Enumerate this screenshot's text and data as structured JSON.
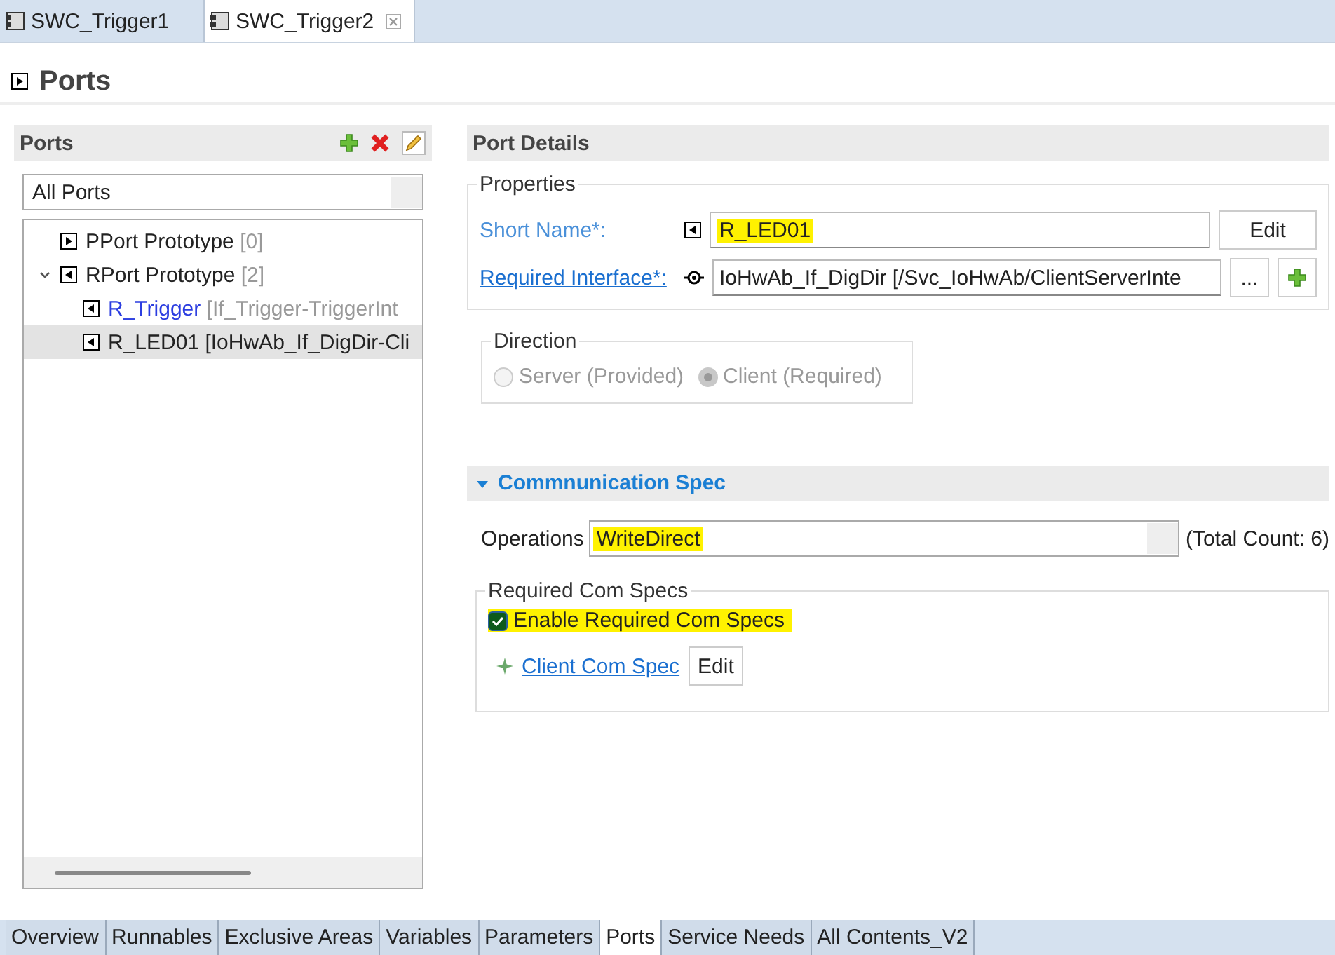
{
  "editor_tabs": [
    {
      "label": "SWC_Trigger1",
      "selected": false,
      "closable": false
    },
    {
      "label": "SWC_Trigger2",
      "selected": true,
      "closable": true
    }
  ],
  "section_title": "Ports",
  "ports_panel": {
    "title": "Ports",
    "filter": "All Ports",
    "tree": [
      {
        "kind": "pport",
        "label": "PPort Prototype",
        "count": "[0]"
      },
      {
        "kind": "rport",
        "label": "RPort Prototype",
        "count": "[2]",
        "expanded": true,
        "children": [
          {
            "kind": "rport",
            "label": "R_Trigger",
            "detail": "[If_Trigger-TriggerInt",
            "linked": true,
            "selected": false
          },
          {
            "kind": "rport",
            "label": "R_LED01",
            "detail": "[IoHwAb_If_DigDir-Cli",
            "linked": false,
            "selected": true
          }
        ]
      }
    ]
  },
  "details": {
    "title": "Port Details",
    "properties": {
      "title": "Properties",
      "short_name": {
        "label": "Short Name*:",
        "value": "R_LED01",
        "highlighted": true,
        "button": "Edit"
      },
      "required_interface": {
        "label": "Required Interface*:",
        "value": "IoHwAb_If_DigDir [/Svc_IoHwAb/ClientServerInte",
        "browse_button": "..."
      }
    },
    "direction": {
      "title": "Direction",
      "disabled": true,
      "options": [
        {
          "label": "Server (Provided)",
          "selected": false
        },
        {
          "label": "Client (Required)",
          "selected": true
        }
      ]
    },
    "communication_spec": {
      "title": "Commnunication Spec",
      "expanded": true,
      "operations": {
        "label": "Operations",
        "value": "WriteDirect",
        "highlighted": true,
        "total": "(Total Count: 6)"
      },
      "required_com_specs": {
        "title": "Required Com Specs",
        "enable": {
          "label": "Enable Required Com Specs",
          "checked": true,
          "highlighted": true
        },
        "client_com_spec": {
          "label": "Client Com Spec",
          "button": "Edit"
        }
      }
    }
  },
  "bottom_tabs": [
    {
      "label": "Overview",
      "selected": false
    },
    {
      "label": "Runnables",
      "selected": false
    },
    {
      "label": "Exclusive Areas",
      "selected": false
    },
    {
      "label": "Variables",
      "selected": false
    },
    {
      "label": "Parameters",
      "selected": false
    },
    {
      "label": "Ports",
      "selected": true
    },
    {
      "label": "Service Needs",
      "selected": false
    },
    {
      "label": "All Contents_V2",
      "selected": false
    }
  ]
}
